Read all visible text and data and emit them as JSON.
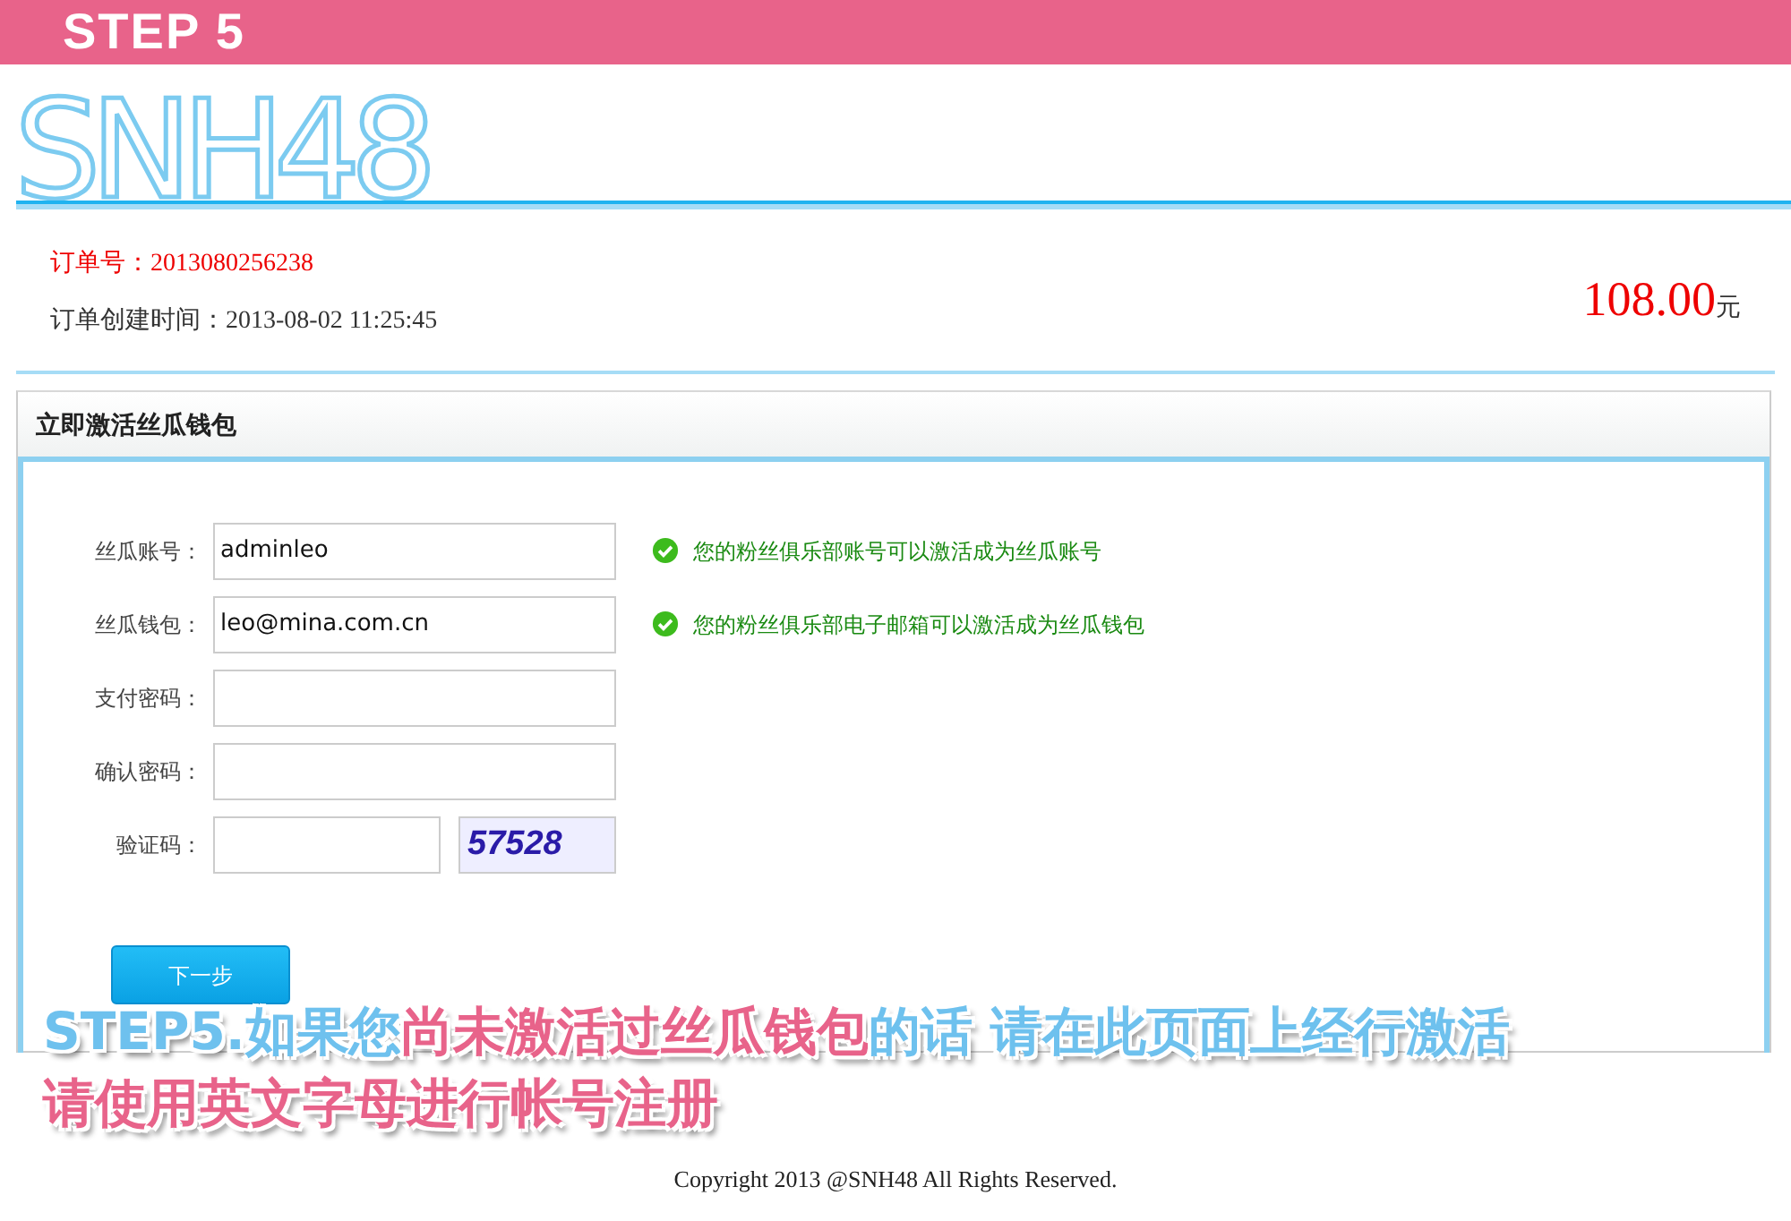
{
  "banner": {
    "title": "STEP 5"
  },
  "logo": {
    "text": "SNH48"
  },
  "order": {
    "number_label": "订单号：",
    "number": "2013080256238",
    "created_label": "订单创建时间：",
    "created": "2013-08-02 11:25:45",
    "amount": "108.00",
    "currency": "元"
  },
  "panel": {
    "title": "立即激活丝瓜钱包",
    "fields": [
      {
        "label": "丝瓜账号：",
        "value": "adminleo",
        "valid": true,
        "message": "您的粉丝俱乐部账号可以激活成为丝瓜账号",
        "kind": "text"
      },
      {
        "label": "丝瓜钱包：",
        "value": "leo@mina.com.cn",
        "valid": true,
        "message": "您的粉丝俱乐部电子邮箱可以激活成为丝瓜钱包",
        "kind": "text"
      },
      {
        "label": "支付密码：",
        "kind": "text"
      },
      {
        "label": "确认密码：",
        "kind": "text"
      },
      {
        "label": "验证码：",
        "kind": "captcha",
        "captcha": "57528"
      }
    ],
    "button": "下一步"
  },
  "caption": {
    "lines": [
      [
        {
          "text": "STEP5.如果您",
          "color": "#6ec1ee"
        },
        {
          "text": "尚未激活过丝瓜钱包",
          "color": "#e8638a"
        },
        {
          "text": "的话 请在此页面上经行激活",
          "color": "#6ec1ee"
        }
      ],
      [
        {
          "text": "请使用英文字母进行帐号注册",
          "color": "#e8638a"
        }
      ]
    ]
  },
  "footer": "Copyright 2013 @SNH48 All Rights Reserved."
}
